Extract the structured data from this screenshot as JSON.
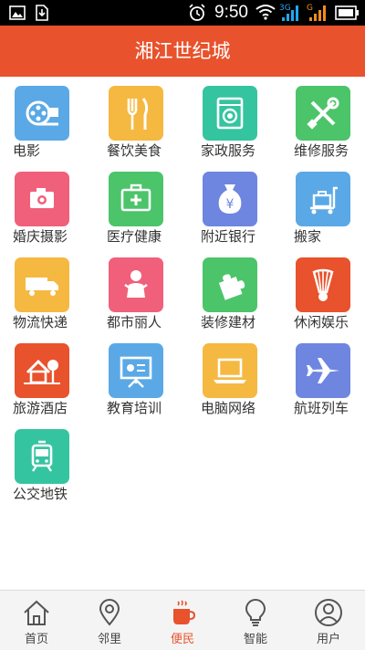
{
  "statusbar": {
    "time": "9:50",
    "net1": "3G",
    "net2": "G"
  },
  "header": {
    "title": "湘江世纪城"
  },
  "services": [
    {
      "label": "电影",
      "color": "#5aa9e6",
      "icon": "film-icon"
    },
    {
      "label": "餐饮美食",
      "color": "#f5b841",
      "icon": "fork-knife-icon"
    },
    {
      "label": "家政服务",
      "color": "#35c4a0",
      "icon": "washing-machine-icon"
    },
    {
      "label": "维修服务",
      "color": "#4cc46a",
      "icon": "tools-icon"
    },
    {
      "label": "婚庆摄影",
      "color": "#f0607a",
      "icon": "camera-icon"
    },
    {
      "label": "医疗健康",
      "color": "#4cc46a",
      "icon": "medical-kit-icon"
    },
    {
      "label": "附近银行",
      "color": "#6e86e0",
      "icon": "money-bag-icon"
    },
    {
      "label": "搬家",
      "color": "#5aa9e6",
      "icon": "luggage-cart-icon"
    },
    {
      "label": "物流快递",
      "color": "#f5b841",
      "icon": "truck-icon"
    },
    {
      "label": "都市丽人",
      "color": "#f0607a",
      "icon": "baby-icon"
    },
    {
      "label": "装修建材",
      "color": "#4cc46a",
      "icon": "puzzle-icon"
    },
    {
      "label": "休闲娱乐",
      "color": "#e8522c",
      "icon": "shuttlecock-icon"
    },
    {
      "label": "旅游酒店",
      "color": "#e8522c",
      "icon": "house-tree-icon"
    },
    {
      "label": "教育培训",
      "color": "#5aa9e6",
      "icon": "presentation-icon"
    },
    {
      "label": "电脑网络",
      "color": "#f5b841",
      "icon": "laptop-icon"
    },
    {
      "label": "航班列车",
      "color": "#6e86e0",
      "icon": "airplane-icon"
    },
    {
      "label": "公交地铁",
      "color": "#35c4a0",
      "icon": "train-icon"
    }
  ],
  "tabs": [
    {
      "label": "首页",
      "icon": "home-icon"
    },
    {
      "label": "邻里",
      "icon": "location-pin-icon"
    },
    {
      "label": "便民",
      "icon": "coffee-cup-icon",
      "active": true
    },
    {
      "label": "智能",
      "icon": "lightbulb-icon"
    },
    {
      "label": "用户",
      "icon": "user-icon"
    }
  ],
  "colors": {
    "accent": "#e8522c",
    "tabbar_bg": "#f4f4f4"
  }
}
